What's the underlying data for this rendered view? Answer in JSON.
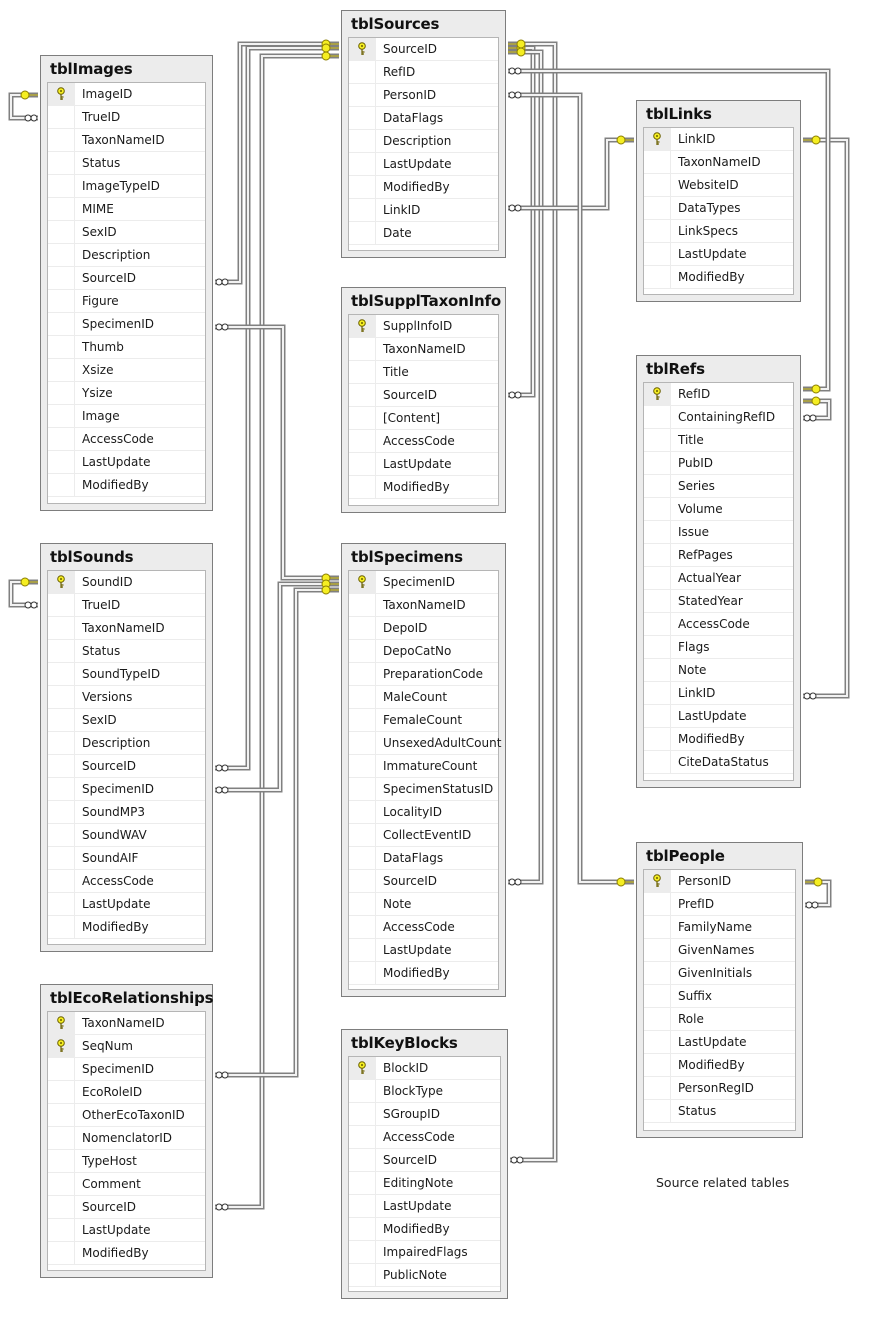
{
  "diagram": {
    "caption": "Source related tables",
    "colors": {
      "table_background": "#ececec",
      "grid_background": "#ffffff",
      "primary_key_icon": "#f5ee22",
      "relationship_line": "#808080"
    }
  },
  "tables": [
    {
      "id": "tblImages",
      "title": "tblImages",
      "columns": [
        {
          "name": "ImageID",
          "pk": true
        },
        {
          "name": "TrueID"
        },
        {
          "name": "TaxonNameID"
        },
        {
          "name": "Status"
        },
        {
          "name": "ImageTypeID"
        },
        {
          "name": "MIME"
        },
        {
          "name": "SexID"
        },
        {
          "name": "Description"
        },
        {
          "name": "SourceID"
        },
        {
          "name": "Figure"
        },
        {
          "name": "SpecimenID"
        },
        {
          "name": "Thumb"
        },
        {
          "name": "Xsize"
        },
        {
          "name": "Ysize"
        },
        {
          "name": "Image"
        },
        {
          "name": "AccessCode"
        },
        {
          "name": "LastUpdate"
        },
        {
          "name": "ModifiedBy"
        }
      ]
    },
    {
      "id": "tblSounds",
      "title": "tblSounds",
      "columns": [
        {
          "name": "SoundID",
          "pk": true
        },
        {
          "name": "TrueID"
        },
        {
          "name": "TaxonNameID"
        },
        {
          "name": "Status"
        },
        {
          "name": "SoundTypeID"
        },
        {
          "name": "Versions"
        },
        {
          "name": "SexID"
        },
        {
          "name": "Description"
        },
        {
          "name": "SourceID"
        },
        {
          "name": "SpecimenID"
        },
        {
          "name": "SoundMP3"
        },
        {
          "name": "SoundWAV"
        },
        {
          "name": "SoundAIF"
        },
        {
          "name": "AccessCode"
        },
        {
          "name": "LastUpdate"
        },
        {
          "name": "ModifiedBy"
        }
      ]
    },
    {
      "id": "tblEcoRelationships",
      "title": "tblEcoRelationships",
      "columns": [
        {
          "name": "TaxonNameID",
          "pk": true
        },
        {
          "name": "SeqNum",
          "pk": true
        },
        {
          "name": "SpecimenID"
        },
        {
          "name": "EcoRoleID"
        },
        {
          "name": "OtherEcoTaxonID"
        },
        {
          "name": "NomenclatorID"
        },
        {
          "name": "TypeHost"
        },
        {
          "name": "Comment"
        },
        {
          "name": "SourceID"
        },
        {
          "name": "LastUpdate"
        },
        {
          "name": "ModifiedBy"
        }
      ]
    },
    {
      "id": "tblSources",
      "title": "tblSources",
      "columns": [
        {
          "name": "SourceID",
          "pk": true
        },
        {
          "name": "RefID"
        },
        {
          "name": "PersonID"
        },
        {
          "name": "DataFlags"
        },
        {
          "name": "Description"
        },
        {
          "name": "LastUpdate"
        },
        {
          "name": "ModifiedBy"
        },
        {
          "name": "LinkID"
        },
        {
          "name": "Date"
        }
      ]
    },
    {
      "id": "tblSupplTaxonInfo",
      "title": "tblSupplTaxonInfo",
      "columns": [
        {
          "name": "SupplInfoID",
          "pk": true
        },
        {
          "name": "TaxonNameID"
        },
        {
          "name": "Title"
        },
        {
          "name": "SourceID"
        },
        {
          "name": "[Content]"
        },
        {
          "name": "AccessCode"
        },
        {
          "name": "LastUpdate"
        },
        {
          "name": "ModifiedBy"
        }
      ]
    },
    {
      "id": "tblSpecimens",
      "title": "tblSpecimens",
      "columns": [
        {
          "name": "SpecimenID",
          "pk": true
        },
        {
          "name": "TaxonNameID"
        },
        {
          "name": "DepoID"
        },
        {
          "name": "DepoCatNo"
        },
        {
          "name": "PreparationCode"
        },
        {
          "name": "MaleCount"
        },
        {
          "name": "FemaleCount"
        },
        {
          "name": "UnsexedAdultCount"
        },
        {
          "name": "ImmatureCount"
        },
        {
          "name": "SpecimenStatusID"
        },
        {
          "name": "LocalityID"
        },
        {
          "name": "CollectEventID"
        },
        {
          "name": "DataFlags"
        },
        {
          "name": "SourceID"
        },
        {
          "name": "Note"
        },
        {
          "name": "AccessCode"
        },
        {
          "name": "LastUpdate"
        },
        {
          "name": "ModifiedBy"
        }
      ]
    },
    {
      "id": "tblKeyBlocks",
      "title": "tblKeyBlocks",
      "columns": [
        {
          "name": "BlockID",
          "pk": true
        },
        {
          "name": "BlockType"
        },
        {
          "name": "SGroupID"
        },
        {
          "name": "AccessCode"
        },
        {
          "name": "SourceID"
        },
        {
          "name": "EditingNote"
        },
        {
          "name": "LastUpdate"
        },
        {
          "name": "ModifiedBy"
        },
        {
          "name": "ImpairedFlags"
        },
        {
          "name": "PublicNote"
        }
      ]
    },
    {
      "id": "tblLinks",
      "title": "tblLinks",
      "columns": [
        {
          "name": "LinkID",
          "pk": true
        },
        {
          "name": "TaxonNameID"
        },
        {
          "name": "WebsiteID"
        },
        {
          "name": "DataTypes"
        },
        {
          "name": "LinkSpecs"
        },
        {
          "name": "LastUpdate"
        },
        {
          "name": "ModifiedBy"
        }
      ]
    },
    {
      "id": "tblRefs",
      "title": "tblRefs",
      "columns": [
        {
          "name": "RefID",
          "pk": true
        },
        {
          "name": "ContainingRefID"
        },
        {
          "name": "Title"
        },
        {
          "name": "PubID"
        },
        {
          "name": "Series"
        },
        {
          "name": "Volume"
        },
        {
          "name": "Issue"
        },
        {
          "name": "RefPages"
        },
        {
          "name": "ActualYear"
        },
        {
          "name": "StatedYear"
        },
        {
          "name": "AccessCode"
        },
        {
          "name": "Flags"
        },
        {
          "name": "Note"
        },
        {
          "name": "LinkID"
        },
        {
          "name": "LastUpdate"
        },
        {
          "name": "ModifiedBy"
        },
        {
          "name": "CiteDataStatus"
        }
      ]
    },
    {
      "id": "tblPeople",
      "title": "tblPeople",
      "columns": [
        {
          "name": "PersonID",
          "pk": true
        },
        {
          "name": "PrefID"
        },
        {
          "name": "FamilyName"
        },
        {
          "name": "GivenNames"
        },
        {
          "name": "GivenInitials"
        },
        {
          "name": "Suffix"
        },
        {
          "name": "Role"
        },
        {
          "name": "LastUpdate"
        },
        {
          "name": "ModifiedBy"
        },
        {
          "name": "PersonRegID"
        },
        {
          "name": "Status"
        }
      ]
    }
  ],
  "relationships": [
    {
      "from": "tblImages.ImageID",
      "to": "tblImages.TrueID"
    },
    {
      "from": "tblSounds.SoundID",
      "to": "tblSounds.TrueID"
    },
    {
      "from": "tblSources.SourceID",
      "to": "tblImages.SourceID"
    },
    {
      "from": "tblSources.SourceID",
      "to": "tblSounds.SourceID"
    },
    {
      "from": "tblSources.SourceID",
      "to": "tblEcoRelationships.SourceID"
    },
    {
      "from": "tblSources.SourceID",
      "to": "tblSupplTaxonInfo.SourceID"
    },
    {
      "from": "tblSources.SourceID",
      "to": "tblSpecimens.SourceID"
    },
    {
      "from": "tblSources.SourceID",
      "to": "tblKeyBlocks.SourceID"
    },
    {
      "from": "tblSpecimens.SpecimenID",
      "to": "tblImages.SpecimenID"
    },
    {
      "from": "tblSpecimens.SpecimenID",
      "to": "tblSounds.SpecimenID"
    },
    {
      "from": "tblSpecimens.SpecimenID",
      "to": "tblEcoRelationships.SpecimenID"
    },
    {
      "from": "tblLinks.LinkID",
      "to": "tblSources.LinkID"
    },
    {
      "from": "tblLinks.LinkID",
      "to": "tblRefs.LinkID"
    },
    {
      "from": "tblRefs.RefID",
      "to": "tblSources.RefID"
    },
    {
      "from": "tblRefs.RefID",
      "to": "tblRefs.ContainingRefID"
    },
    {
      "from": "tblPeople.PersonID",
      "to": "tblSources.PersonID"
    },
    {
      "from": "tblPeople.PersonID",
      "to": "tblPeople.PrefID"
    }
  ]
}
